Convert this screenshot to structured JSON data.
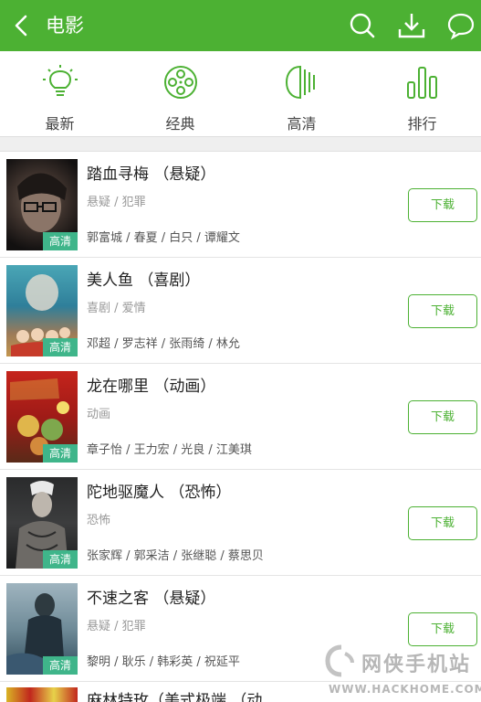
{
  "header": {
    "title": "电影",
    "icons": [
      "back-icon",
      "search-icon",
      "download-icon",
      "message-icon"
    ]
  },
  "categories": [
    {
      "label": "最新",
      "icon": "lightbulb-icon"
    },
    {
      "label": "经典",
      "icon": "film-reel-icon"
    },
    {
      "label": "高清",
      "icon": "hd-lines-icon"
    },
    {
      "label": "排行",
      "icon": "bar-chart-icon"
    }
  ],
  "movies": [
    {
      "title": "踏血寻梅 （悬疑）",
      "genre": "悬疑 / 犯罪",
      "cast": "郭富城 / 春夏 / 白只 / 谭耀文",
      "badge": "高清",
      "button": "下载"
    },
    {
      "title": "美人鱼 （喜剧）",
      "genre": "喜剧 / 爱情",
      "cast": "邓超 / 罗志祥 / 张雨绮 / 林允",
      "badge": "高清",
      "button": "下载"
    },
    {
      "title": "龙在哪里 （动画）",
      "genre": "动画",
      "cast": "章子怡 / 王力宏 / 光良 / 江美琪",
      "badge": "高清",
      "button": "下载"
    },
    {
      "title": "陀地驱魔人 （恐怖）",
      "genre": "恐怖",
      "cast": "张家辉 / 郭采洁 / 张继聪 / 蔡思贝",
      "badge": "高清",
      "button": "下载"
    },
    {
      "title": "不速之客 （悬疑）",
      "genre": "悬疑 / 犯罪",
      "cast": "黎明 / 耿乐 / 韩彩英 / 祝延平",
      "badge": "高清",
      "button": "下载"
    }
  ],
  "partial_item": {
    "title": "麻林特玫（美式极端 （动"
  },
  "watermark": {
    "name": "网侠手机站",
    "url": "WWW.HACKHOME.COM"
  },
  "colors": {
    "accent": "#4cb133",
    "badge": "#3fb58a"
  }
}
